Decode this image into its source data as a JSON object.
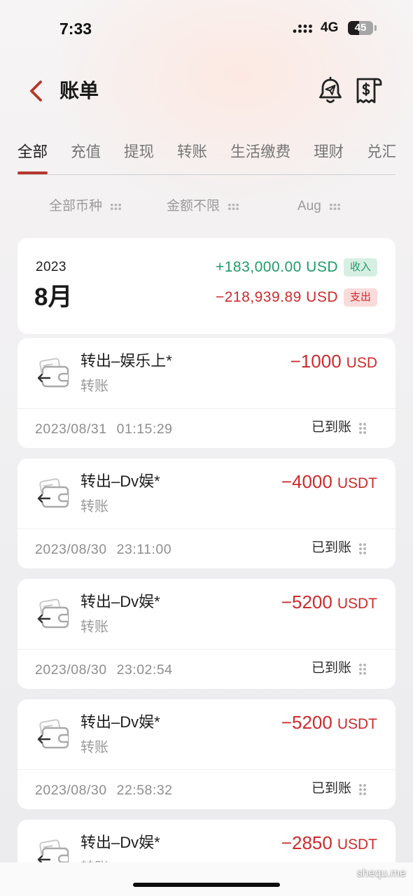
{
  "status_bar": {
    "time": "7:33",
    "network": "4G",
    "battery": "45",
    "signal_icon": "signal-dots-icon",
    "battery_icon": "battery-icon"
  },
  "header": {
    "title": "账单",
    "back_icon": "chevron-left-icon",
    "notification_icon": "bell-icon",
    "receipt_icon": "receipt-dollar-icon"
  },
  "tabs": [
    {
      "label": "全部",
      "active": true
    },
    {
      "label": "充值",
      "active": false
    },
    {
      "label": "提现",
      "active": false
    },
    {
      "label": "转账",
      "active": false
    },
    {
      "label": "生活缴费",
      "active": false
    },
    {
      "label": "理财",
      "active": false
    },
    {
      "label": "兑汇",
      "active": false
    }
  ],
  "filters": [
    {
      "label": "全部币种",
      "icon": "more-dots-icon"
    },
    {
      "label": "金额不限",
      "icon": "more-dots-icon"
    },
    {
      "label": "Aug",
      "icon": "more-dots-icon"
    }
  ],
  "summary": {
    "year": "2023",
    "month": "8月",
    "income": "+183,000.00 USD",
    "income_badge": "收入",
    "expense": "−218,939.89 USD",
    "expense_badge": "支出"
  },
  "transactions": [
    {
      "title": "转出–娱乐上*",
      "type": "转账",
      "amount": "−1000",
      "currency": "USD",
      "date": "2023/08/31",
      "time": "01:15:29",
      "status": "已到账",
      "icon": "wallet-transfer-out-icon"
    },
    {
      "title": "转出–Dv娱*",
      "type": "转账",
      "amount": "−4000",
      "currency": "USDT",
      "date": "2023/08/30",
      "time": "23:11:00",
      "status": "已到账",
      "icon": "wallet-transfer-out-icon"
    },
    {
      "title": "转出–Dv娱*",
      "type": "转账",
      "amount": "−5200",
      "currency": "USDT",
      "date": "2023/08/30",
      "time": "23:02:54",
      "status": "已到账",
      "icon": "wallet-transfer-out-icon"
    },
    {
      "title": "转出–Dv娱*",
      "type": "转账",
      "amount": "−5200",
      "currency": "USDT",
      "date": "2023/08/30",
      "time": "22:58:32",
      "status": "已到账",
      "icon": "wallet-transfer-out-icon"
    },
    {
      "title": "转出–Dv娱*",
      "type": "转账",
      "amount": "−2850",
      "currency": "USDT",
      "icon": "wallet-transfer-out-icon"
    }
  ],
  "watermark": "shequ.me",
  "colors": {
    "accent_red": "#b5382c",
    "expense_red": "#cc2c2c",
    "income_green": "#1e9b67",
    "income_badge_bg": "#d7efe3",
    "expense_badge_bg": "#fadbdb"
  }
}
